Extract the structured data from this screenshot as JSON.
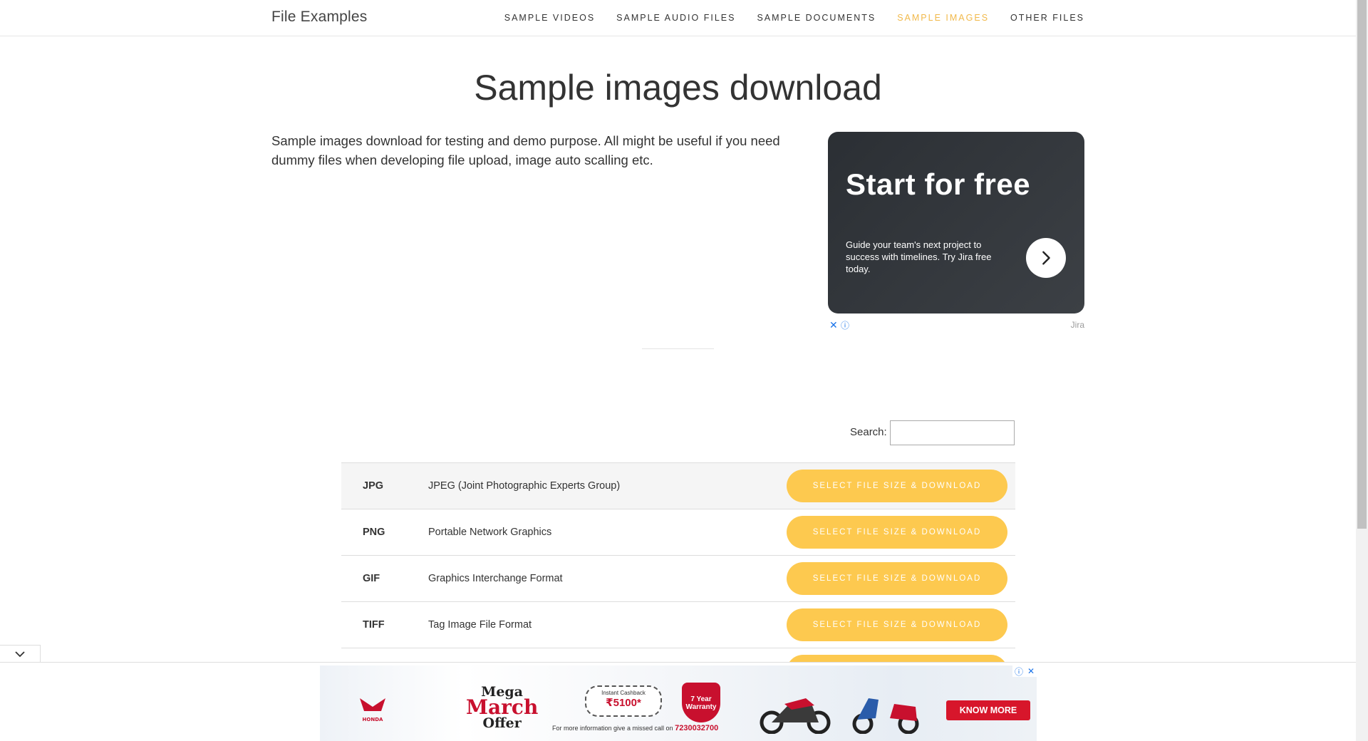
{
  "header": {
    "brand": "File Examples",
    "nav": [
      {
        "label": "SAMPLE VIDEOS",
        "active": false
      },
      {
        "label": "SAMPLE AUDIO FILES",
        "active": false
      },
      {
        "label": "SAMPLE DOCUMENTS",
        "active": false
      },
      {
        "label": "SAMPLE IMAGES",
        "active": true
      },
      {
        "label": "OTHER FILES",
        "active": false
      }
    ],
    "active_color": "#f1b94b"
  },
  "page": {
    "title": "Sample images download",
    "intro": "Sample images download for testing and demo purpose. All might be useful if you need dummy files when developing file upload, image auto scalling etc."
  },
  "side_ad": {
    "title": "Start for free",
    "text": "Guide your team's next project to success with timelines. Try Jira free today.",
    "brand": "Jira",
    "close_glyph": "✕",
    "info_glyph": "ⓘ",
    "arrow_icon": "chevron-right-icon"
  },
  "search": {
    "label": "Search:",
    "value": "",
    "placeholder": ""
  },
  "table": {
    "button_label": "SELECT FILE SIZE & DOWNLOAD",
    "button_color": "#fdc94f",
    "rows": [
      {
        "ext": "JPG",
        "desc": "JPEG (Joint Photographic Experts Group)"
      },
      {
        "ext": "PNG",
        "desc": "Portable Network Graphics"
      },
      {
        "ext": "GIF",
        "desc": "Graphics Interchange Format"
      },
      {
        "ext": "TIFF",
        "desc": "Tag Image File Format"
      }
    ]
  },
  "bottom_ad": {
    "brand": "HONDA",
    "mega": "Mega",
    "march": "March",
    "offer": "Offer",
    "cashback_label": "Instant Cashback",
    "cashback_amount": "₹5100*",
    "shield_text": "7 Year Warranty",
    "fine_print": "For more information give a missed call on",
    "phone": "7230032700",
    "cta": "KNOW MORE",
    "collapse_icon": "chevron-down-icon"
  }
}
